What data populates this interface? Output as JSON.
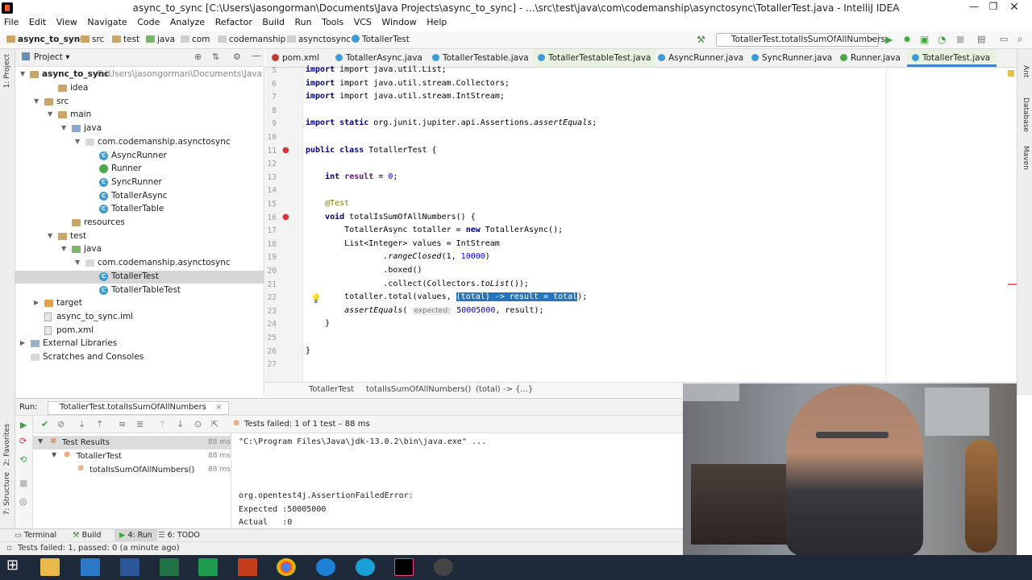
{
  "window": {
    "title": "async_to_sync [C:\\Users\\jasongorman\\Documents\\Java Projects\\async_to_sync] - ...\\src\\test\\java\\com\\codemanship\\asynctosync\\TotallerTest.java - IntelliJ IDEA"
  },
  "menu": [
    "File",
    "Edit",
    "View",
    "Navigate",
    "Code",
    "Analyze",
    "Refactor",
    "Build",
    "Run",
    "Tools",
    "VCS",
    "Window",
    "Help"
  ],
  "breadcrumbs": [
    "async_to_sync",
    "src",
    "test",
    "java",
    "com",
    "codemanship",
    "asynctosync",
    "TotallerTest"
  ],
  "run_config": "TotallerTest.totalIsSumOfAllNumbers",
  "project_panel": {
    "title": "Project",
    "root_name": "async_to_sync",
    "root_path": "C:\\Users\\jasongorman\\Documents\\Java Project",
    "items": [
      {
        "label": "idea",
        "depth": 2,
        "icon": "folder"
      },
      {
        "label": "src",
        "depth": 1,
        "icon": "folder"
      },
      {
        "label": "main",
        "depth": 2,
        "icon": "folder"
      },
      {
        "label": "java",
        "depth": 3,
        "icon": "folder-blue"
      },
      {
        "label": "com.codemanship.asynctosync",
        "depth": 4,
        "icon": "package"
      },
      {
        "label": "AsyncRunner",
        "depth": 5,
        "icon": "class"
      },
      {
        "label": "Runner",
        "depth": 5,
        "icon": "runnable"
      },
      {
        "label": "SyncRunner",
        "depth": 5,
        "icon": "class"
      },
      {
        "label": "TotallerAsync",
        "depth": 5,
        "icon": "class"
      },
      {
        "label": "TotallerTable",
        "depth": 5,
        "icon": "class"
      },
      {
        "label": "resources",
        "depth": 3,
        "icon": "folder"
      },
      {
        "label": "test",
        "depth": 2,
        "icon": "folder"
      },
      {
        "label": "java",
        "depth": 3,
        "icon": "folder-green"
      },
      {
        "label": "com.codemanship.asynctosync",
        "depth": 4,
        "icon": "package"
      },
      {
        "label": "TotallerTest",
        "depth": 5,
        "icon": "class"
      },
      {
        "label": "TotallerTableTest",
        "depth": 5,
        "icon": "class"
      },
      {
        "label": "target",
        "depth": 1,
        "icon": "folder-orange"
      },
      {
        "label": "async_to_sync.iml",
        "depth": 1,
        "icon": "file"
      },
      {
        "label": "pom.xml",
        "depth": 1,
        "icon": "file"
      },
      {
        "label": "External Libraries",
        "depth": 0,
        "icon": "library"
      },
      {
        "label": "Scratches and Consoles",
        "depth": 0,
        "icon": "scratch"
      }
    ]
  },
  "tabs": [
    {
      "label": "pom.xml",
      "color": "#c0392b"
    },
    {
      "label": "TotallerAsync.java",
      "color": "#3d9bd6"
    },
    {
      "label": "TotallerTestable.java",
      "color": "#3d9bd6"
    },
    {
      "label": "TotallerTestableTest.java",
      "color": "#3d9bd6"
    },
    {
      "label": "AsyncRunner.java",
      "color": "#3d9bd6"
    },
    {
      "label": "SyncRunner.java",
      "color": "#3d9bd6"
    },
    {
      "label": "Runner.java",
      "color": "#4ca74c"
    },
    {
      "label": "TotallerTest.java",
      "color": "#3d9bd6"
    }
  ],
  "code": {
    "line_numbers": [
      "5",
      "6",
      "7",
      "8",
      "9",
      "10",
      "11",
      "12",
      "13",
      "14",
      "15",
      "16",
      "17",
      "18",
      "19",
      "20",
      "21",
      "22",
      "23",
      "24",
      "25",
      "26",
      "27"
    ],
    "l5": "import java.util.List;",
    "l6": "import java.util.stream.Collectors;",
    "l7": "import java.util.stream.IntStream;",
    "l9a": "import static ",
    "l9b": "org.junit.jupiter.api.Assertions.",
    "l9c": "assertEquals",
    "l11a": "public class ",
    "l11b": "TotallerTest {",
    "l13a": "int ",
    "l13b": "result = ",
    "l13c": "0",
    "l15": "@Test",
    "l16a": "void ",
    "l16b": "totalIsSumOfAllNumbers() {",
    "l17a": "TotallerAsync totaller = ",
    "l17b": "new ",
    "l17c": "TotallerAsync();",
    "l18": "List<Integer> values = IntStream",
    "l19a": ".rangeClosed",
    "l19b": "(1, ",
    "l19c": "10000",
    "l19d": ")",
    "l20": ".boxed()",
    "l21a": ".collect(Collectors.",
    "l21b": "toList",
    "l21c": "());",
    "l22a": "totaller.total(values, ",
    "l22b": "(total) -> result = total",
    "l22c": ");",
    "l23a": "assertEquals",
    "l23b": "( ",
    "l23hint": "expected:",
    "l23c": " 50005000",
    "l23d": ", result);",
    "l24": "}",
    "l26": "}"
  },
  "editor_breadcrumb": [
    "TotallerTest",
    "totalIsSumOfAllNumbers()",
    "(total) -> {...}"
  ],
  "run": {
    "label": "Run:",
    "tab": "TotallerTest.totalIsSumOfAllNumbers",
    "status": "Tests failed: 1 of 1 test – 88 ms",
    "tree": [
      {
        "label": "Test Results",
        "time": "88 ms"
      },
      {
        "label": "TotallerTest",
        "time": "88 ms"
      },
      {
        "label": "totalIsSumOfAllNumbers()",
        "time": "88 ms"
      }
    ],
    "console": [
      "\"C:\\Program Files\\Java\\jdk-13.0.2\\bin\\java.exe\" ...",
      "",
      "",
      "org.opentest4j.AssertionFailedError:",
      "Expected :50005000",
      "Actual   :0"
    ]
  },
  "tool_tabs": [
    "Terminal",
    "Build",
    "4: Run",
    "6: TODO"
  ],
  "status_text": "Tests failed: 1, passed: 0 (a minute ago)",
  "left_stripe": [
    "1: Project",
    "2: Favorites",
    "7: Structure"
  ],
  "right_stripe": [
    "Ant",
    "Database",
    "Maven"
  ]
}
